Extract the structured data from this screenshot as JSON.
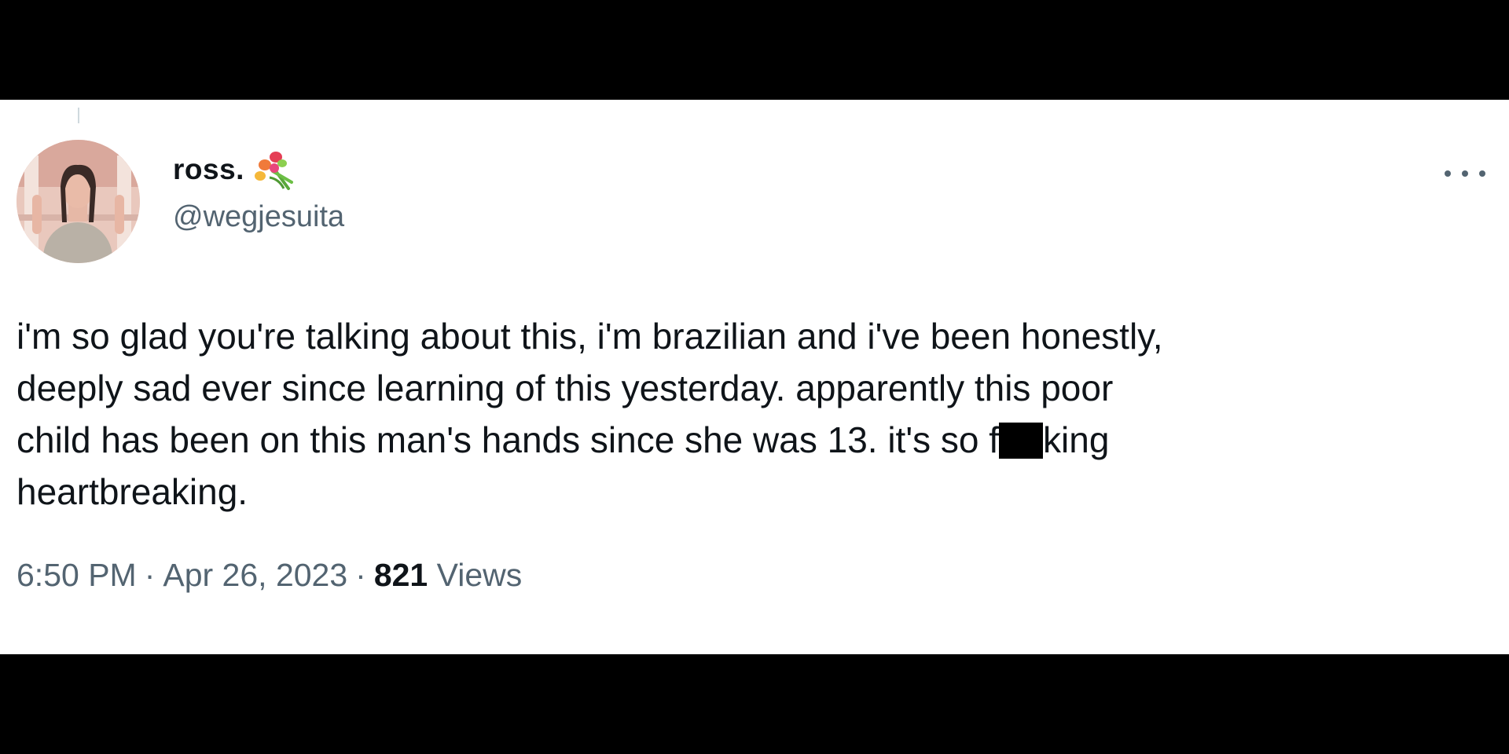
{
  "tweet": {
    "author": {
      "display_name": "ross.",
      "name_emoji_icon": "bouquet-icon",
      "handle": "@wegjesuita",
      "avatar_icon": "profile-photo"
    },
    "more_icon": "more-horizontal-icon",
    "text": {
      "line_1": "i'm so glad you're talking about this, i'm brazilian and i've been honestly,",
      "line_2": "deeply sad ever since learning of this yesterday. apparently this poor",
      "line_3_before": "child has been on this man's hands since she was 13. it's so f",
      "line_3_after": "king",
      "line_4": "heartbreaking."
    },
    "meta": {
      "time": "6:50 PM",
      "separator": "·",
      "date": "Apr 26, 2023",
      "views_count": "821",
      "views_label": "Views"
    }
  },
  "colors": {
    "background_band": "#000000",
    "card": "#ffffff",
    "primary_text": "#0f1419",
    "secondary_text": "#536471"
  }
}
